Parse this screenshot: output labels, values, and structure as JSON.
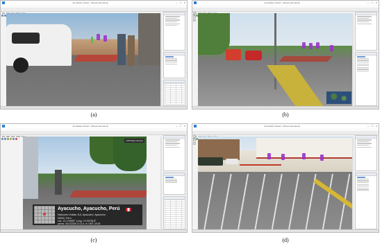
{
  "window_title": "Annotation Viewer - [Street panorama]",
  "menu": [
    "File",
    "Edit",
    "View",
    "Tools",
    "Help"
  ],
  "captions": {
    "a": "(a)",
    "b": "(b)",
    "c": "(c)",
    "d": "(d)"
  },
  "panel_c": {
    "location_title": "Ayacucho, Ayacucho, Perú",
    "address_line1": "Naciones Unidas 110, Ayacucho, Ayacucho",
    "address_line2": "05002, Perú",
    "coords": "Lat -13.174599° Long -74.207615°",
    "datetime": "jueves, 04/12/2025 11:12 a. m. GMT -05:00",
    "badge": "GPS Map Camera"
  },
  "icons": [
    "app-icon",
    "minimize-icon",
    "maximize-icon",
    "close-icon",
    "map-pin-icon",
    "flag-icon"
  ]
}
